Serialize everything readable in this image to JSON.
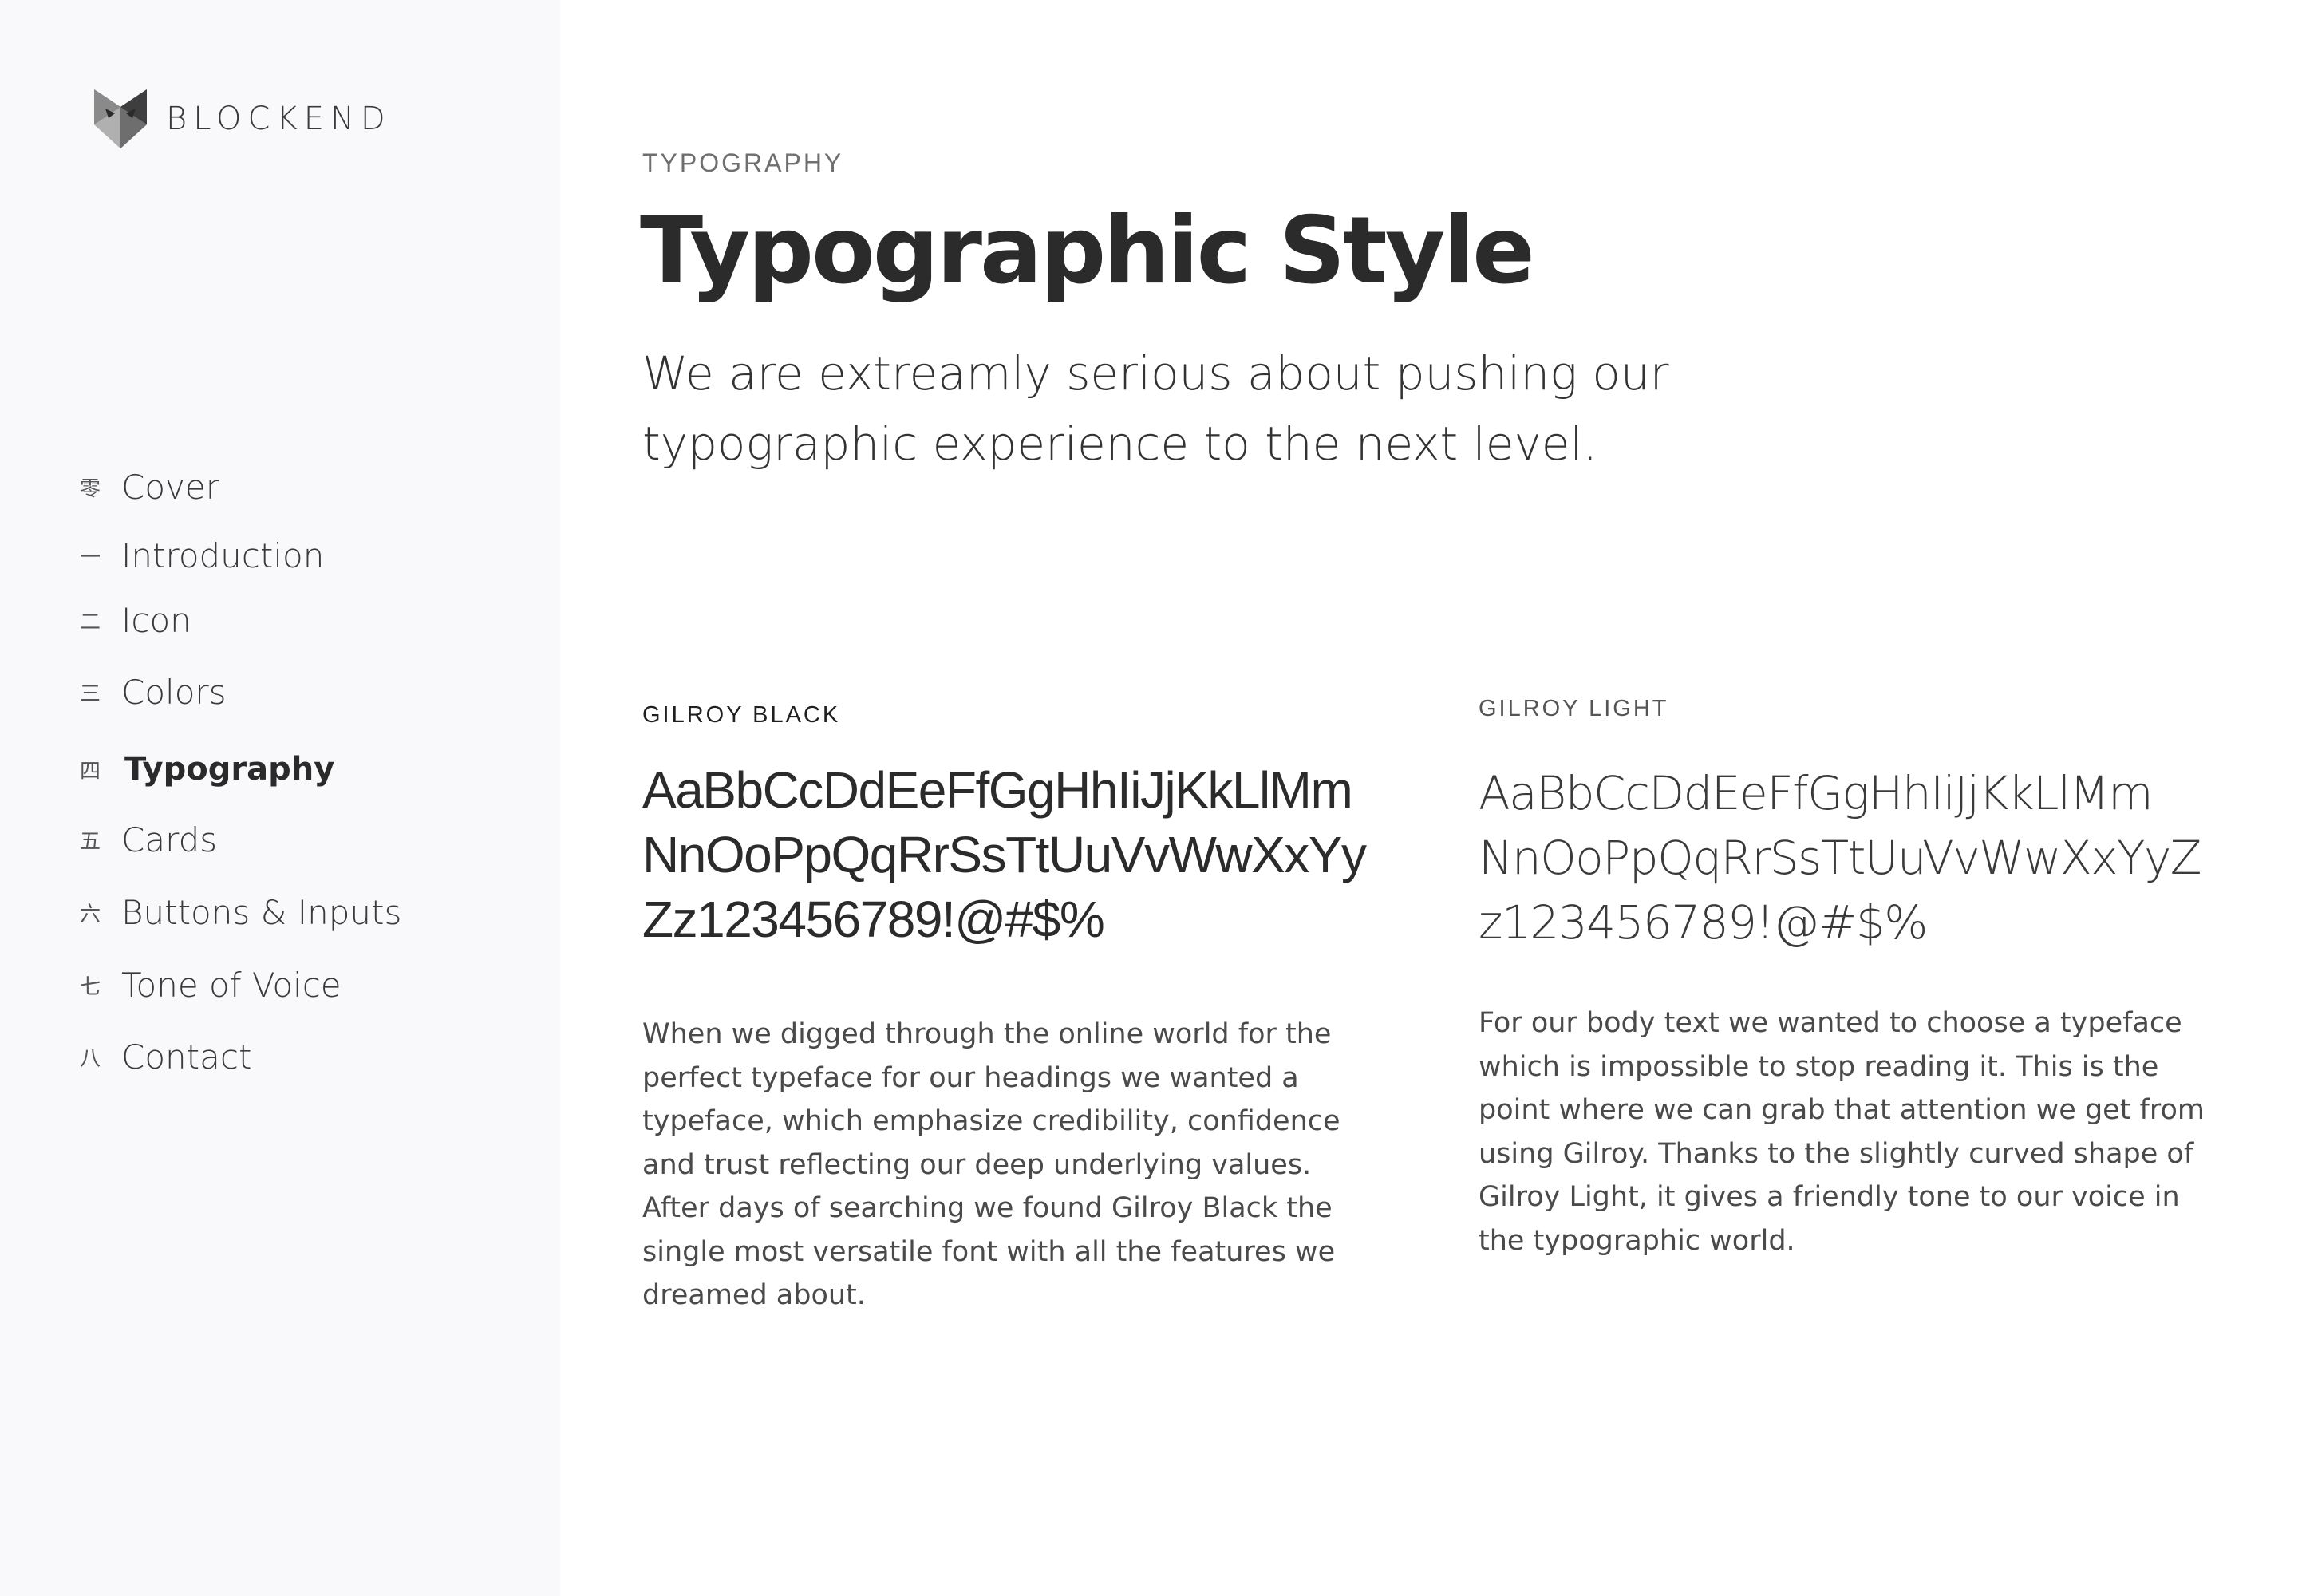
{
  "brand": {
    "name": "BLOCKEND",
    "logo_icon": "fox-head-icon"
  },
  "nav": {
    "items": [
      {
        "num": "零",
        "label": "Cover"
      },
      {
        "num": "一",
        "label": "Introduction"
      },
      {
        "num": "二",
        "label": "Icon"
      },
      {
        "num": "三",
        "label": "Colors"
      },
      {
        "num": "四",
        "label": "Typography",
        "active": true
      },
      {
        "num": "五",
        "label": "Cards"
      },
      {
        "num": "六",
        "label": "Buttons & Inputs"
      },
      {
        "num": "七",
        "label": "Tone of Voice"
      },
      {
        "num": "八",
        "label": "Contact"
      }
    ]
  },
  "header": {
    "eyebrow": "TYPOGRAPHY",
    "title": "Typographic Style",
    "lead": "We are extreamly serious about pushing our typographic experience to the next level."
  },
  "fonts": {
    "black": {
      "name": "GILROY BLACK",
      "specimen": [
        "AaBbCcDdEeFfGgHhIiJjKkLlMm",
        "NnOoPpQqRrSsTtUuVvWwXxYy",
        "Zz123456789!@#$%"
      ],
      "body": "When we digged through the online world for the perfect typeface for our headings we wanted a typeface, which emphasize credibility, confidence and trust reflecting our deep underlying values. After days of searching we found Gilroy Black the single most versatile font with all the features we dreamed about."
    },
    "light": {
      "name": "GILROY LIGHT",
      "specimen": [
        "AaBbCcDdEeFfGgHhIiJjKkLlMm",
        "NnOoPpQqRrSsTtUuVvWwXxYyZ",
        "z123456789!@#$%"
      ],
      "body": "For our body text we wanted to choose a typeface which is impossible to stop reading it. This is the point where we can grab that attention we get from using Gilroy. Thanks to the slightly curved shape of Gilroy Light, it gives a friendly tone to our voice in the typographic world."
    }
  },
  "colors": {
    "sidebar_bg": "#f9f9fb",
    "text_primary": "#2b2b2b",
    "text_muted": "#6f6f6f"
  }
}
